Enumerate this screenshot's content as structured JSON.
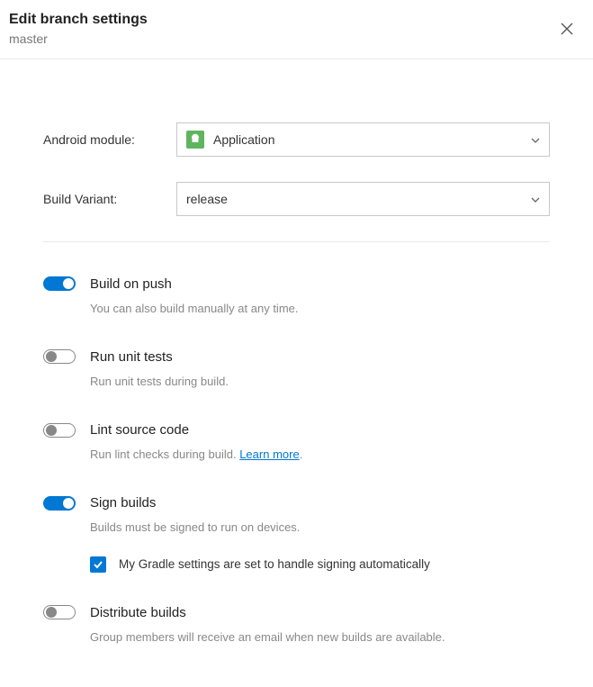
{
  "header": {
    "title": "Edit branch settings",
    "branch": "master"
  },
  "form": {
    "androidModule": {
      "label": "Android module:",
      "value": "Application"
    },
    "buildVariant": {
      "label": "Build Variant:",
      "value": "release"
    }
  },
  "toggles": {
    "buildOnPush": {
      "title": "Build on push",
      "desc": "You can also build manually at any time.",
      "on": true
    },
    "runTests": {
      "title": "Run unit tests",
      "desc": "Run unit tests during build.",
      "on": false
    },
    "lint": {
      "title": "Lint source code",
      "descPrefix": "Run lint checks during build. ",
      "learnMore": "Learn more",
      "on": false
    },
    "sign": {
      "title": "Sign builds",
      "desc": "Builds must be signed to run on devices.",
      "on": true,
      "checkboxLabel": "My Gradle settings are set to handle signing automatically"
    },
    "distribute": {
      "title": "Distribute builds",
      "desc": "Group members will receive an email when new builds are available.",
      "on": false
    }
  }
}
